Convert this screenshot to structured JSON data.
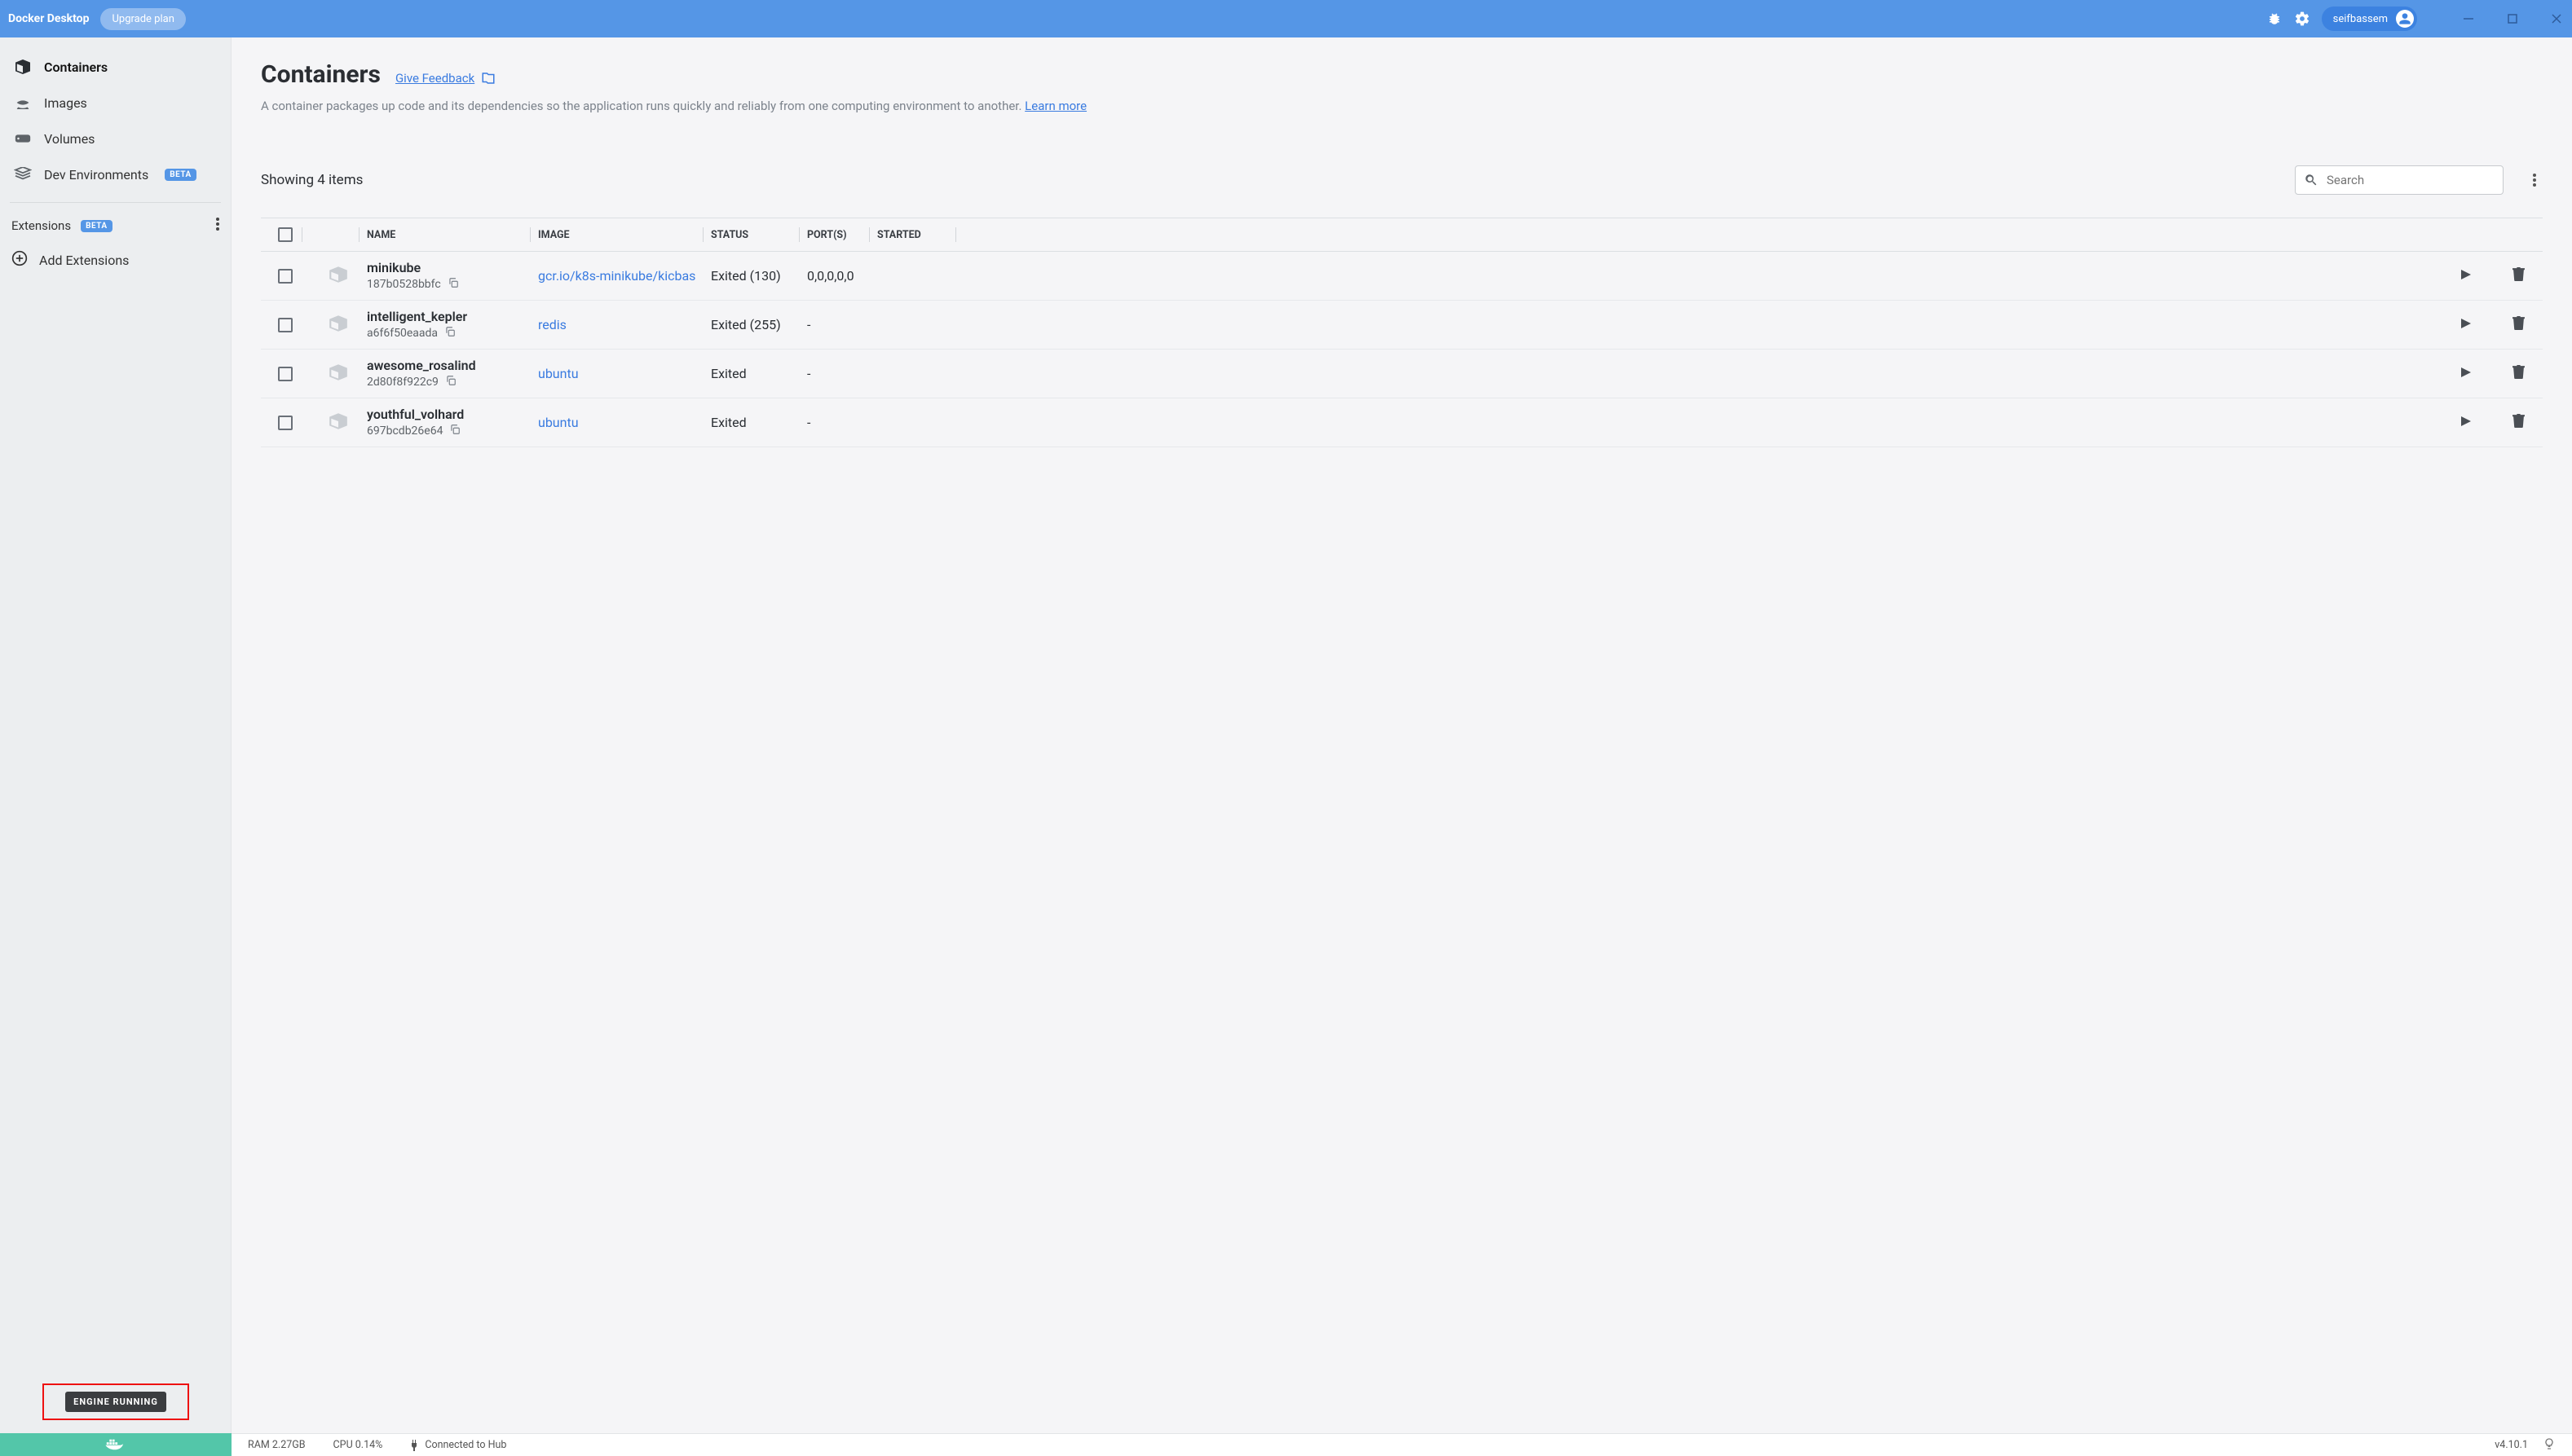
{
  "titlebar": {
    "app": "Docker Desktop",
    "upgrade": "Upgrade plan",
    "user": "seifbassem"
  },
  "sidebar": {
    "items": [
      {
        "label": "Containers"
      },
      {
        "label": "Images"
      },
      {
        "label": "Volumes"
      },
      {
        "label": "Dev Environments",
        "badge": "BETA"
      }
    ],
    "extensions_title": "Extensions",
    "extensions_badge": "BETA",
    "add_ext": "Add Extensions",
    "engine": "ENGINE RUNNING"
  },
  "page": {
    "title": "Containers",
    "feedback": "Give Feedback",
    "desc_pre": "A container packages up code and its dependencies so the application runs quickly and reliably from one computing environment to another. ",
    "desc_link": "Learn more",
    "showing": "Showing 4 items",
    "search_placeholder": "Search"
  },
  "columns": {
    "name": "NAME",
    "image": "IMAGE",
    "status": "STATUS",
    "ports": "PORT(S)",
    "started": "STARTED"
  },
  "rows": [
    {
      "name": "minikube",
      "hash": "187b0528bbfc",
      "image": "gcr.io/k8s-minikube/kicbas",
      "status": "Exited (130)",
      "ports": "0,0,0,0,0",
      "started": ""
    },
    {
      "name": "intelligent_kepler",
      "hash": "a6f6f50eaada",
      "image": "redis",
      "status": "Exited (255)",
      "ports": "-",
      "started": ""
    },
    {
      "name": "awesome_rosalind",
      "hash": "2d80f8f922c9",
      "image": "ubuntu",
      "status": "Exited",
      "ports": "-",
      "started": ""
    },
    {
      "name": "youthful_volhard",
      "hash": "697bcdb26e64",
      "image": "ubuntu",
      "status": "Exited",
      "ports": "-",
      "started": ""
    }
  ],
  "footer": {
    "ram": "RAM 2.27GB",
    "cpu": "CPU 0.14%",
    "hub": "Connected to Hub",
    "version": "v4.10.1"
  }
}
